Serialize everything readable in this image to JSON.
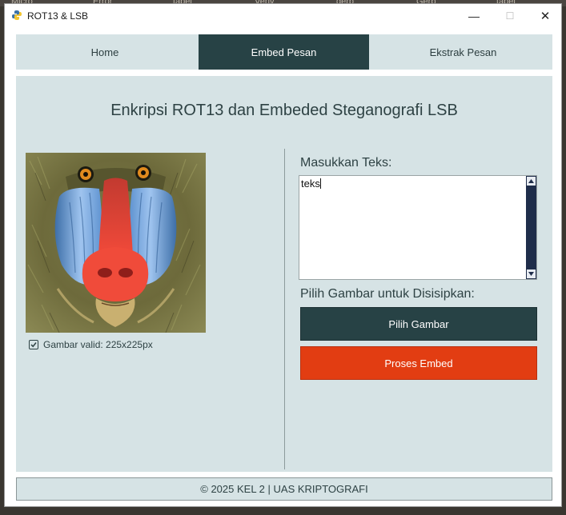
{
  "window": {
    "title": "ROT13 & LSB",
    "controls": {
      "minimize": "—",
      "maximize": "☐",
      "close": "✕"
    }
  },
  "background_tabs": [
    "Micro",
    "Error",
    "tabel",
    "Venv",
    "gerb",
    "Gerb",
    "tabel"
  ],
  "nav": {
    "tabs": [
      {
        "label": "Home",
        "active": false
      },
      {
        "label": "Embed Pesan",
        "active": true
      },
      {
        "label": "Ekstrak Pesan",
        "active": false
      }
    ]
  },
  "main": {
    "title": "Enkripsi ROT13 dan Embeded Steganografi LSB",
    "image_status": "Gambar valid: 225x225px",
    "image_status_checked": true,
    "text_label": "Masukkan Teks:",
    "text_value": "teks",
    "image_label": "Pilih Gambar untuk Disisipkan:",
    "choose_button": "Pilih Gambar",
    "process_button": "Proses Embed"
  },
  "footer": {
    "text": "© 2025 KEL 2 | UAS KRIPTOGRAFI"
  },
  "colors": {
    "panel": "#d6e3e5",
    "dark_accent": "#274245",
    "orange_accent": "#e23d12",
    "scrollbar": "#1f2d4a"
  },
  "icons": {
    "app": "python-icon",
    "check": "checkbox-checked-icon",
    "scroll_up": "triangle-up-icon",
    "scroll_down": "triangle-down-icon"
  }
}
